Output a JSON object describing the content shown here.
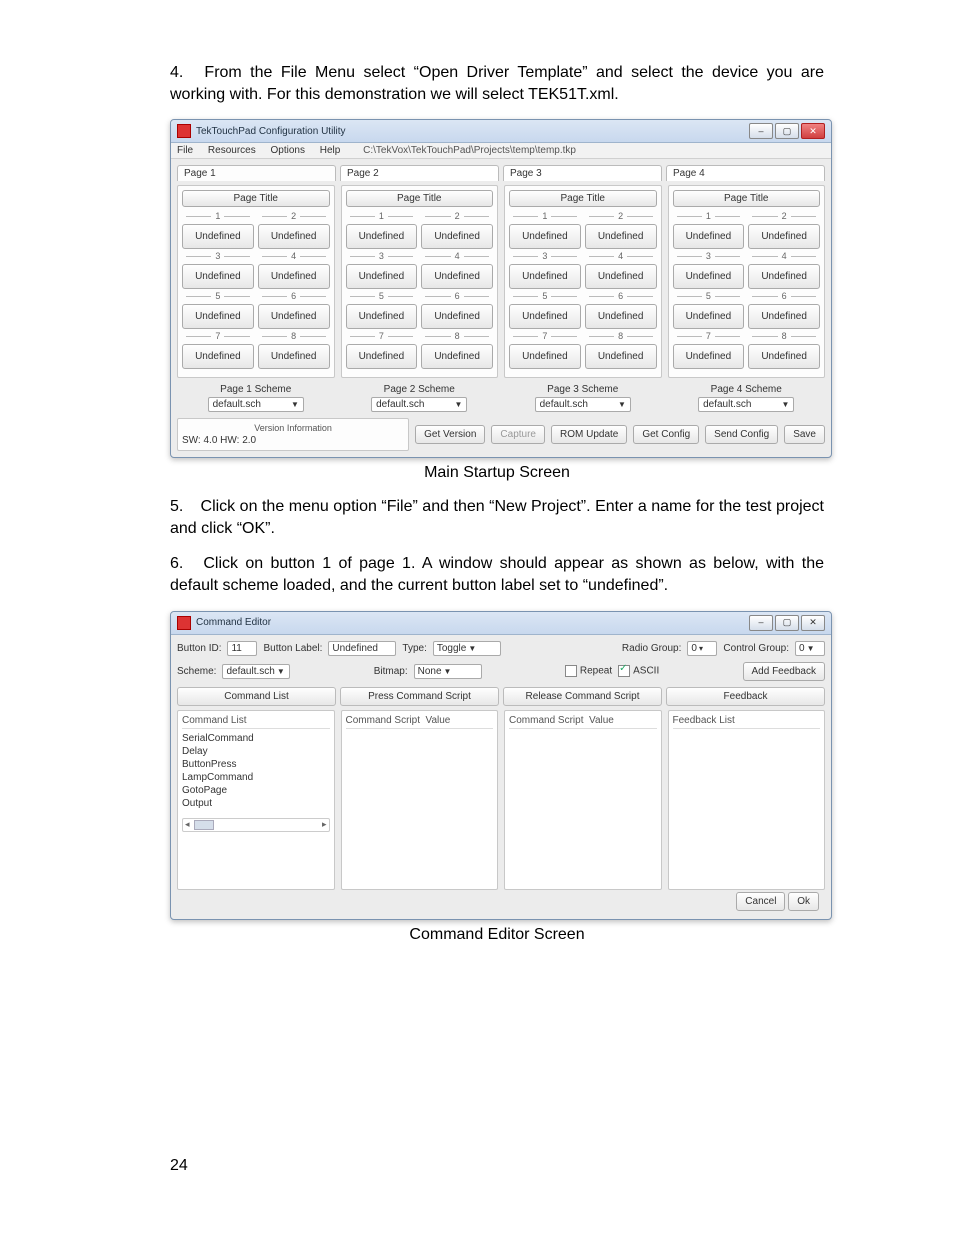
{
  "instructions": {
    "step4_num": "4.",
    "step4": "From the File Menu select “Open Driver Template” and select the device you are working with. For this demonstration we will select TEK51T.xml.",
    "step5_num": "5.",
    "step5": "Click on the menu option “File” and then “New Project”. Enter a name for the test project and click “OK”.",
    "step6_num": "6.",
    "step6": "Click on button 1 of page 1. A window should appear as shown as below, with the default scheme loaded, and the current button label set to “undefined”."
  },
  "captions": {
    "main": "Main Startup Screen",
    "cmd": "Command Editor Screen"
  },
  "page_number": "24",
  "win1": {
    "title": "TekTouchPad Configuration Utility",
    "menus": [
      "File",
      "Resources",
      "Options",
      "Help"
    ],
    "path": "C:\\TekVox\\TekTouchPad\\Projects\\temp\\temp.tkp",
    "tabs": [
      "Page 1",
      "Page 2",
      "Page 3",
      "Page 4"
    ],
    "page_title_btn": "Page Title",
    "cell_nums": [
      "1",
      "2",
      "3",
      "4",
      "5",
      "6",
      "7",
      "8"
    ],
    "cell_label": "Undefined",
    "scheme_labels": [
      "Page 1 Scheme",
      "Page 2 Scheme",
      "Page 3 Scheme",
      "Page 4 Scheme"
    ],
    "scheme_value": "default.sch",
    "version_box_title": "Version Information",
    "version_text": "SW: 4.0   HW: 2.0",
    "buttons": {
      "get_version": "Get Version",
      "capture": "Capture",
      "rom_update": "ROM Update",
      "get_config": "Get Config",
      "send_config": "Send Config",
      "save": "Save"
    }
  },
  "win2": {
    "title": "Command Editor",
    "labels": {
      "button_id": "Button ID:",
      "button_id_val": "11",
      "button_label": "Button Label:",
      "button_label_val": "Undefined",
      "type": "Type:",
      "type_val": "Toggle",
      "radio_group": "Radio Group:",
      "radio_group_val": "0",
      "control_group": "Control Group:",
      "control_group_val": "0",
      "scheme": "Scheme:",
      "scheme_val": "default.sch",
      "bitmap": "Bitmap:",
      "bitmap_val": "None",
      "repeat": "Repeat",
      "ascii": "ASCII",
      "add_feedback": "Add Feedback"
    },
    "tabs": [
      "Command List",
      "Press Command Script",
      "Release Command Script",
      "Feedback"
    ],
    "cmd_hdr": "Command List",
    "cmd_items": [
      "SerialCommand",
      "Delay",
      "ButtonPress",
      "LampCommand",
      "GotoPage",
      "Output"
    ],
    "script_hdr_cmd": "Command Script",
    "script_hdr_val": "Value",
    "feedback_hdr": "Feedback List",
    "footer": {
      "cancel": "Cancel",
      "ok": "Ok"
    }
  }
}
